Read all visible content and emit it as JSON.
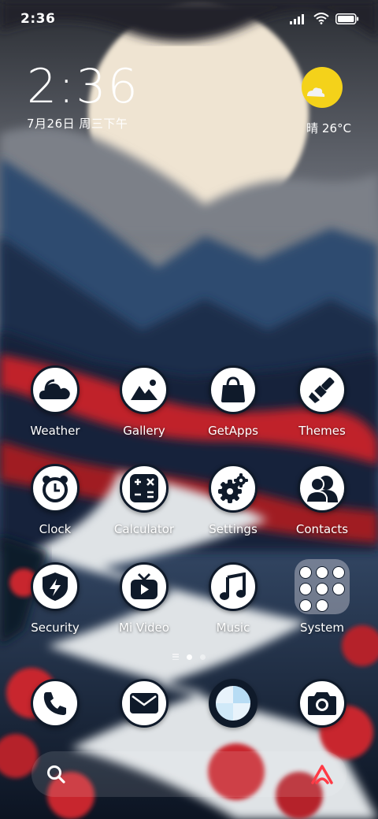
{
  "status_bar": {
    "time": "2:36",
    "icons": [
      "signal-icon",
      "wifi-icon",
      "battery-icon"
    ]
  },
  "clock_widget": {
    "time": "2:36",
    "date": "7月26日 周三下午"
  },
  "weather_widget": {
    "icon": "sunny-cloud-icon",
    "condition_temp": "晴 26°C"
  },
  "apps": [
    {
      "label": "Weather",
      "icon": "weather-icon"
    },
    {
      "label": "Gallery",
      "icon": "gallery-icon"
    },
    {
      "label": "GetApps",
      "icon": "getapps-icon"
    },
    {
      "label": "Themes",
      "icon": "themes-icon"
    },
    {
      "label": "Clock",
      "icon": "clock-icon"
    },
    {
      "label": "Calculator",
      "icon": "calculator-icon"
    },
    {
      "label": "Settings",
      "icon": "settings-icon"
    },
    {
      "label": "Contacts",
      "icon": "contacts-icon"
    },
    {
      "label": "Security",
      "icon": "security-icon"
    },
    {
      "label": "Mi Video",
      "icon": "mi-video-icon"
    },
    {
      "label": "Music",
      "icon": "music-icon"
    },
    {
      "label": "System",
      "icon": "folder-icon"
    }
  ],
  "pager": {
    "pages": 2,
    "active": 1
  },
  "dock": [
    {
      "name": "phone",
      "icon": "phone-icon"
    },
    {
      "name": "messages",
      "icon": "mail-icon"
    },
    {
      "name": "browser",
      "icon": "browser-icon"
    },
    {
      "name": "camera",
      "icon": "camera-icon"
    }
  ],
  "search_bar": {
    "left_icon": "search-icon",
    "right_icon": "assistant-icon"
  },
  "colors": {
    "sun": "#f4d21a",
    "icon_bg": "#ffffff",
    "icon_outline": "#0f1a2a"
  }
}
